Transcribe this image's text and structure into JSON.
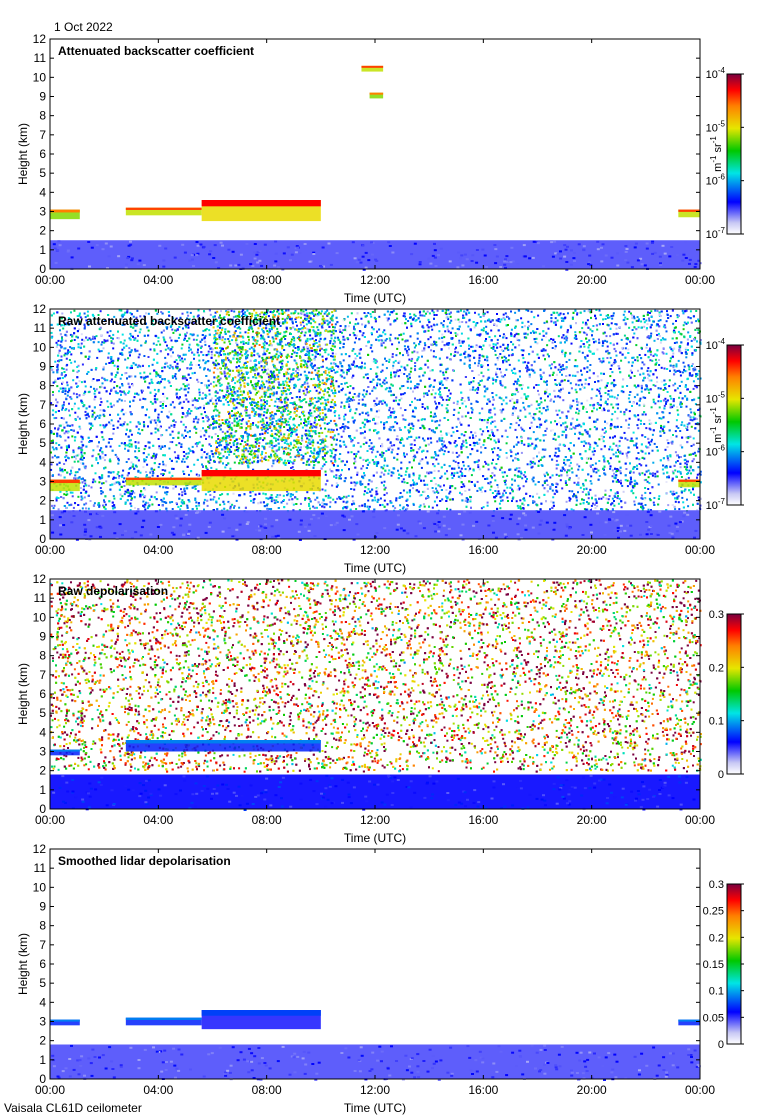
{
  "header": {
    "date": "1 Oct 2022"
  },
  "footer": {
    "instrument": "Vaisala CL61D ceilometer"
  },
  "chart_data": [
    {
      "type": "heatmap",
      "title": "Attenuated backscatter coefficient",
      "xlabel": "Time (UTC)",
      "ylabel": "Height (km)",
      "x_ticks": [
        "00:00",
        "04:00",
        "08:00",
        "12:00",
        "16:00",
        "20:00",
        "00:00"
      ],
      "y_ticks": [
        0,
        1,
        2,
        3,
        4,
        5,
        6,
        7,
        8,
        9,
        10,
        11,
        12
      ],
      "xlim": [
        0,
        24
      ],
      "ylim": [
        0,
        12
      ],
      "colorbar": {
        "scale": "log",
        "range": [
          1e-07,
          0.0001
        ],
        "ticks": [
          {
            "base": "10",
            "exp": "-7",
            "value": 1e-07
          },
          {
            "base": "10",
            "exp": "-6",
            "value": 1e-06
          },
          {
            "base": "10",
            "exp": "-5",
            "value": 1e-05
          },
          {
            "base": "10",
            "exp": "-4",
            "value": 0.0001
          }
        ],
        "unit": {
          "a": "m",
          "ae": "-1",
          "b": " sr",
          "be": "-1"
        }
      },
      "features": [
        {
          "name": "boundary-layer",
          "t0": 0,
          "t1": 24,
          "h0": 0,
          "h1": 1.5,
          "level": 0.15
        },
        {
          "name": "cloud-layer",
          "t0": 0,
          "t1": 1.1,
          "h0": 2.6,
          "h1": 3.1,
          "level": 0.8
        },
        {
          "name": "cloud-layer",
          "t0": 2.8,
          "t1": 5.6,
          "h0": 2.8,
          "h1": 3.2,
          "level": 0.85
        },
        {
          "name": "cloud-layer",
          "t0": 5.6,
          "t1": 10.0,
          "h0": 2.5,
          "h1": 3.6,
          "level": 0.9
        },
        {
          "name": "cloud-layer",
          "t0": 23.2,
          "t1": 24,
          "h0": 2.7,
          "h1": 3.1,
          "level": 0.85
        },
        {
          "name": "cirrus",
          "t0": 11.5,
          "t1": 12.3,
          "h0": 10.3,
          "h1": 10.6,
          "level": 0.85
        },
        {
          "name": "cirrus",
          "t0": 11.8,
          "t1": 12.3,
          "h0": 8.9,
          "h1": 9.2,
          "level": 0.8
        }
      ]
    },
    {
      "type": "heatmap",
      "title": "Raw attenuated backscatter coefficient",
      "xlabel": "Time (UTC)",
      "ylabel": "Height (km)",
      "x_ticks": [
        "00:00",
        "04:00",
        "08:00",
        "12:00",
        "16:00",
        "20:00",
        "00:00"
      ],
      "y_ticks": [
        0,
        1,
        2,
        3,
        4,
        5,
        6,
        7,
        8,
        9,
        10,
        11,
        12
      ],
      "xlim": [
        0,
        24
      ],
      "ylim": [
        0,
        12
      ],
      "colorbar": {
        "scale": "log",
        "range": [
          1e-07,
          0.0001
        ],
        "ticks": [
          {
            "base": "10",
            "exp": "-7",
            "value": 1e-07
          },
          {
            "base": "10",
            "exp": "-6",
            "value": 1e-06
          },
          {
            "base": "10",
            "exp": "-5",
            "value": 1e-05
          },
          {
            "base": "10",
            "exp": "-4",
            "value": 0.0001
          }
        ],
        "unit": {
          "a": "m",
          "ae": "-1",
          "b": " sr",
          "be": "-1"
        }
      },
      "features": [
        {
          "name": "noise-background",
          "t0": 0,
          "t1": 24,
          "h0": 1.5,
          "h1": 12,
          "level": 0.45
        },
        {
          "name": "noise-daytime",
          "t0": 6,
          "t1": 10.5,
          "h0": 4,
          "h1": 12,
          "level": 0.7
        },
        {
          "name": "boundary-layer",
          "t0": 0,
          "t1": 24,
          "h0": 0,
          "h1": 1.5,
          "level": 0.15
        },
        {
          "name": "cloud-layer",
          "t0": 0,
          "t1": 1.1,
          "h0": 2.5,
          "h1": 3.1,
          "level": 0.85
        },
        {
          "name": "cloud-layer",
          "t0": 2.8,
          "t1": 5.6,
          "h0": 2.8,
          "h1": 3.2,
          "level": 0.85
        },
        {
          "name": "cloud-layer",
          "t0": 5.6,
          "t1": 10.0,
          "h0": 2.5,
          "h1": 3.6,
          "level": 0.9
        },
        {
          "name": "cloud-layer",
          "t0": 23.2,
          "t1": 24,
          "h0": 2.7,
          "h1": 3.1,
          "level": 0.85
        }
      ]
    },
    {
      "type": "heatmap",
      "title": "Raw depolarisation",
      "xlabel": "Time (UTC)",
      "ylabel": "Height (km)",
      "x_ticks": [
        "00:00",
        "04:00",
        "08:00",
        "12:00",
        "16:00",
        "20:00",
        "00:00"
      ],
      "y_ticks": [
        0,
        1,
        2,
        3,
        4,
        5,
        6,
        7,
        8,
        9,
        10,
        11,
        12
      ],
      "xlim": [
        0,
        24
      ],
      "ylim": [
        0,
        12
      ],
      "colorbar": {
        "scale": "linear",
        "range": [
          0,
          0.3
        ],
        "ticks": [
          {
            "label": "0",
            "value": 0
          },
          {
            "label": "0.1",
            "value": 0.1
          },
          {
            "label": "0.2",
            "value": 0.2
          },
          {
            "label": "0.3",
            "value": 0.3
          }
        ]
      },
      "features": [
        {
          "name": "noise-background",
          "t0": 0,
          "t1": 24,
          "h0": 2.0,
          "h1": 12,
          "level": 1.0
        },
        {
          "name": "boundary-layer",
          "t0": 0,
          "t1": 24,
          "h0": 0,
          "h1": 1.8,
          "level": 0.2
        },
        {
          "name": "cloud-layer",
          "t0": 0,
          "t1": 1.1,
          "h0": 2.8,
          "h1": 3.1,
          "level": 0.3
        },
        {
          "name": "cloud-layer",
          "t0": 2.8,
          "t1": 10.0,
          "h0": 3.0,
          "h1": 3.6,
          "level": 0.3
        }
      ]
    },
    {
      "type": "heatmap",
      "title": "Smoothed lidar depolarisation",
      "xlabel": "Time (UTC)",
      "ylabel": "Height (km)",
      "x_ticks": [
        "00:00",
        "04:00",
        "08:00",
        "12:00",
        "16:00",
        "20:00",
        "00:00"
      ],
      "y_ticks": [
        0,
        1,
        2,
        3,
        4,
        5,
        6,
        7,
        8,
        9,
        10,
        11,
        12
      ],
      "xlim": [
        0,
        24
      ],
      "ylim": [
        0,
        12
      ],
      "colorbar": {
        "scale": "linear",
        "range": [
          0,
          0.3
        ],
        "ticks": [
          {
            "label": "0",
            "value": 0
          },
          {
            "label": "0.05",
            "value": 0.05
          },
          {
            "label": "0.1",
            "value": 0.1
          },
          {
            "label": "0.15",
            "value": 0.15
          },
          {
            "label": "0.2",
            "value": 0.2
          },
          {
            "label": "0.25",
            "value": 0.25
          },
          {
            "label": "0.3",
            "value": 0.3
          }
        ]
      },
      "features": [
        {
          "name": "boundary-layer",
          "t0": 0,
          "t1": 24,
          "h0": 0,
          "h1": 1.8,
          "level": 0.15
        },
        {
          "name": "cloud-layer",
          "t0": 0,
          "t1": 1.1,
          "h0": 2.8,
          "h1": 3.1,
          "level": 0.3
        },
        {
          "name": "cloud-layer",
          "t0": 2.8,
          "t1": 5.6,
          "h0": 2.8,
          "h1": 3.2,
          "level": 0.3
        },
        {
          "name": "cloud-layer",
          "t0": 5.6,
          "t1": 10.0,
          "h0": 2.6,
          "h1": 3.6,
          "level": 0.25
        },
        {
          "name": "cloud-layer",
          "t0": 23.2,
          "t1": 24,
          "h0": 2.8,
          "h1": 3.1,
          "level": 0.3
        }
      ]
    }
  ]
}
